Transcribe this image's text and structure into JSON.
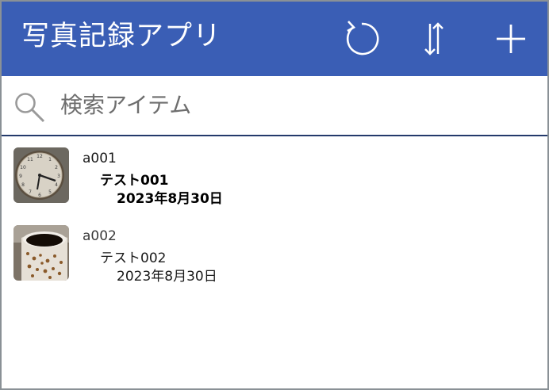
{
  "header": {
    "title": "写真記録アプリ",
    "background": "#3a5eb5",
    "buttons": [
      {
        "name": "refresh",
        "icon": "refresh-icon"
      },
      {
        "name": "sort",
        "icon": "sort-icon"
      },
      {
        "name": "add",
        "icon": "plus-icon"
      }
    ]
  },
  "search": {
    "placeholder": "検索アイテム",
    "value": "",
    "icon": "search-icon"
  },
  "items": [
    {
      "id": "a001",
      "title": "テスト001",
      "date": "2023年8月30日",
      "selected": true,
      "image": "clock-photo"
    },
    {
      "id": "a002",
      "title": "テスト002",
      "date": "2023年8月30日",
      "selected": false,
      "image": "coffee-cup-photo"
    }
  ]
}
